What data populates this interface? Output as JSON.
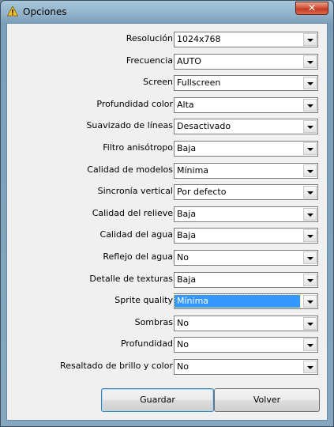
{
  "window": {
    "title": "Opciones",
    "close_glyph": "✕",
    "title_icon": "warning-icon"
  },
  "settings": [
    {
      "label": "Resolución",
      "value": "1024x768"
    },
    {
      "label": "Frecuencia",
      "value": "AUTO"
    },
    {
      "label": "Screen",
      "value": "Fullscreen"
    },
    {
      "label": "Profundidad color",
      "value": "Alta"
    },
    {
      "label": "Suavizado de líneas",
      "value": "Desactivado"
    },
    {
      "label": "Filtro anisótropo",
      "value": "Baja"
    },
    {
      "label": "Calidad de modelos",
      "value": "Mínima"
    },
    {
      "label": "Sincronía vertical",
      "value": "Por defecto"
    },
    {
      "label": "Calidad del relieve",
      "value": "Baja"
    },
    {
      "label": "Calidad del agua",
      "value": "Baja"
    },
    {
      "label": "Reflejo del agua",
      "value": "No"
    },
    {
      "label": "Detalle de texturas",
      "value": "Baja"
    },
    {
      "label": "Sprite quality",
      "value": "Mínima",
      "focused": true
    },
    {
      "label": "Sombras",
      "value": "No"
    },
    {
      "label": "Profundidad",
      "value": "No"
    },
    {
      "label": "Resaltado de brillo y color",
      "value": "No"
    }
  ],
  "buttons": {
    "save": "Guardar",
    "back": "Volver"
  }
}
